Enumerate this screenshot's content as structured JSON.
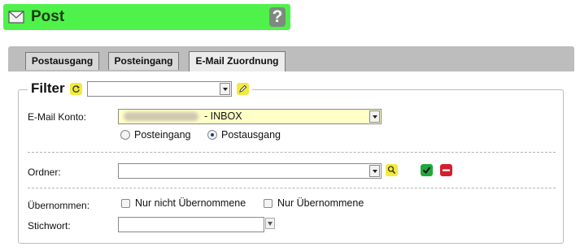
{
  "window": {
    "title": "Post",
    "help_label": "?"
  },
  "tabs": [
    {
      "label": "Postausgang",
      "active": false
    },
    {
      "label": "Posteingang",
      "active": false
    },
    {
      "label": "E-Mail Zuordnung",
      "active": true
    }
  ],
  "filter": {
    "legend": "Filter",
    "preset_value": "",
    "email_account": {
      "label": "E-Mail Konto:",
      "value_suffix": "- INBOX"
    },
    "direction": {
      "options": [
        {
          "label": "Posteingang",
          "selected": false
        },
        {
          "label": "Postausgang",
          "selected": true
        }
      ]
    },
    "folder": {
      "label": "Ordner:",
      "value": ""
    },
    "taken_over": {
      "label": "Übernommen:",
      "options": [
        {
          "label": "Nur nicht Übernommene",
          "checked": false
        },
        {
          "label": "Nur Übernommene",
          "checked": false
        }
      ]
    },
    "keyword": {
      "label": "Stichwort:",
      "value": ""
    }
  },
  "colors": {
    "title_bar": "#4ff24a",
    "highlight_field": "#ffffc8",
    "accent_yellow": "#f2ea3c",
    "confirm_green": "#1fa83a",
    "cancel_red": "#d61d2d"
  },
  "icons": [
    "mail-icon",
    "help-icon",
    "refresh-icon",
    "edit-pencil-icon",
    "search-icon",
    "confirm-check-icon",
    "remove-minus-icon",
    "dropdown-arrow-icon"
  ]
}
